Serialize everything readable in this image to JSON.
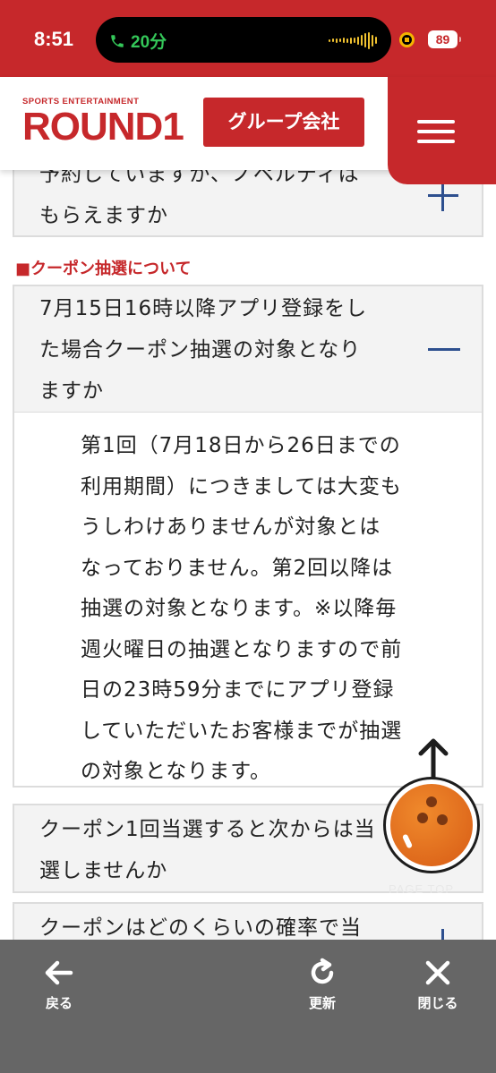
{
  "status_bar": {
    "time": "8:51",
    "call_duration": "20分",
    "battery": "89"
  },
  "header": {
    "logo_small": "SPORTS ENTERTAINMENT",
    "logo_main": "ROUND1",
    "group_button": "グループ会社"
  },
  "faq_top": {
    "question": "予約していますか、ノペルティは\nもらえますか"
  },
  "section": {
    "heading": "■クーポン抽選について"
  },
  "faq_open": {
    "question": "7月15日16時以降アプリ登録をし\nた場合クーポン抽選の対象となり\nますか",
    "answer": "第1回（7月18日から26日までの\n利用期間）につきましては大変も\nうしわけありませんが対象とは\nなっておりません。第2回以降は\n抽選の対象となります。※以降毎\n週火曜日の抽選となりますので前\n日の23時59分までにアプリ登録\nしていただいたお客様までが抽選\nの対象となります。"
  },
  "faq_3": {
    "question": "クーポン1回当選すると次からは当\n選しませんか"
  },
  "faq_4": {
    "question": "クーポンはどのくらいの確率で当"
  },
  "page_top": {
    "label": "PAGE TOP"
  },
  "toolbar": {
    "back": "戻る",
    "refresh": "更新",
    "close": "閉じる"
  },
  "colors": {
    "brand_red": "#c6282b",
    "accent_blue": "#2d4f8e",
    "toolbar_gray": "#666666"
  }
}
